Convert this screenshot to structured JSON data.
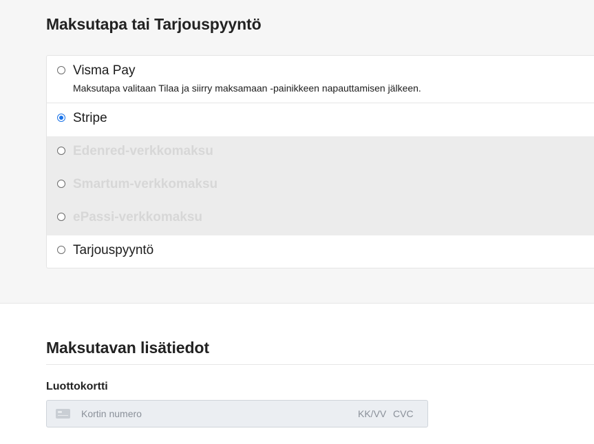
{
  "payment": {
    "title": "Maksutapa tai Tarjouspyyntö",
    "methods": [
      {
        "label": "Visma Pay",
        "description": "Maksutapa valitaan Tilaa ja siirry maksamaan -painikkeen napauttamisen jälkeen.",
        "selected": false,
        "disabled": false
      },
      {
        "label": "Stripe",
        "selected": true,
        "disabled": false
      },
      {
        "label": "Edenred-verkkomaksu",
        "selected": false,
        "disabled": true
      },
      {
        "label": "Smartum-verkkomaksu",
        "selected": false,
        "disabled": true
      },
      {
        "label": "ePassi-verkkomaksu",
        "selected": false,
        "disabled": true
      },
      {
        "label": "Tarjouspyyntö",
        "selected": false,
        "disabled": false
      }
    ]
  },
  "details": {
    "title": "Maksutavan lisätiedot",
    "card_label": "Luottokortti",
    "card_number_placeholder": "Kortin numero",
    "expiry_placeholder": "KK/VV",
    "cvc_placeholder": "CVC"
  },
  "colors": {
    "accent": "#1a73e8",
    "disabled_row": "#ececec",
    "section_bg": "#f6f6f6"
  },
  "icons": {
    "card": "credit-card-icon"
  }
}
